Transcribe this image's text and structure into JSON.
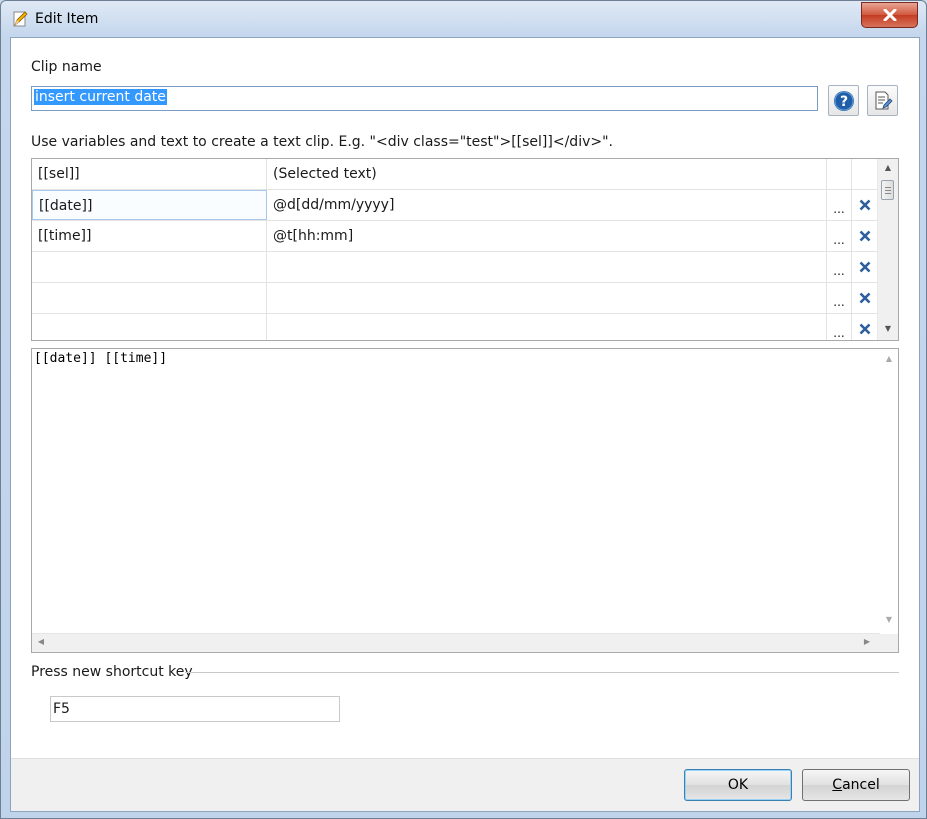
{
  "window": {
    "title": "Edit Item"
  },
  "clip_name": {
    "label": "Clip name",
    "value": "insert current date"
  },
  "help_tooltip_icon": "help-icon",
  "edit_icon": "edit-document-icon",
  "hint": "Use variables and text to create a text clip. E.g. \"<div class=\"test\">[[sel]]</div>\".",
  "variables": [
    {
      "name": "[[sel]]",
      "value": "(Selected text)",
      "more": "",
      "remove": false
    },
    {
      "name": "[[date]]",
      "value": "@d[dd/mm/yyyy]",
      "more": "...",
      "remove": true
    },
    {
      "name": "[[time]]",
      "value": "@t[hh:mm]",
      "more": "...",
      "remove": true
    },
    {
      "name": "",
      "value": "",
      "more": "...",
      "remove": true
    },
    {
      "name": "",
      "value": "",
      "more": "...",
      "remove": true
    },
    {
      "name": "",
      "value": "",
      "more": "...",
      "remove": true
    }
  ],
  "editor": {
    "content": "[[date]] [[time]]"
  },
  "shortcut": {
    "label": "Press new shortcut key",
    "value": "F5"
  },
  "buttons": {
    "ok": "OK",
    "cancel_prefix": "C",
    "cancel_rest": "ancel"
  },
  "colors": {
    "accent": "#3399ff",
    "remove_icon": "#2d5f9e",
    "help_icon": "#1f5ea8"
  }
}
